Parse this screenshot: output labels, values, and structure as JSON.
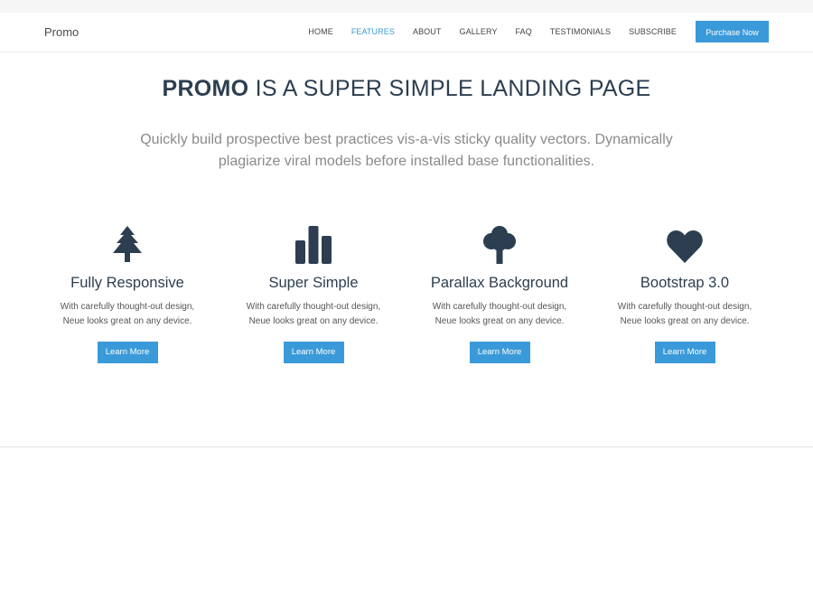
{
  "nav": {
    "brand": "Promo",
    "links": [
      "HOME",
      "FEATURES",
      "ABOUT",
      "GALLERY",
      "FAQ",
      "TESTIMONIALS",
      "SUBSCRIBE"
    ],
    "active": "FEATURES",
    "purchase_label": "Purchase Now"
  },
  "hero": {
    "title_bold": "PROMO",
    "title_rest": "IS A SUPER SIMPLE LANDING PAGE",
    "subtitle": "Quickly build prospective best practices vis-a-vis sticky quality vectors. Dynamically plagiarize viral models before installed base functionalities."
  },
  "features": [
    {
      "icon": "tree-icon",
      "title": "Fully Responsive",
      "text_line1": "With carefully thought-out design,",
      "text_line2": "Neue looks great on any device.",
      "button": "Learn More"
    },
    {
      "icon": "bar-chart-icon",
      "title": "Super Simple",
      "text_line1": "With carefully thought-out design,",
      "text_line2": "Neue looks great on any device.",
      "button": "Learn More"
    },
    {
      "icon": "deciduous-tree-icon",
      "title": "Parallax Background",
      "text_line1": "With carefully thought-out design,",
      "text_line2": "Neue looks great on any device.",
      "button": "Learn More"
    },
    {
      "icon": "heart-icon",
      "title": "Bootstrap 3.0",
      "text_line1": "With carefully thought-out design,",
      "text_line2": "Neue looks great on any device.",
      "button": "Learn More"
    }
  ],
  "colors": {
    "accent": "#3a9ad9",
    "heading": "#2c3e50",
    "icon": "#2c3e50"
  }
}
